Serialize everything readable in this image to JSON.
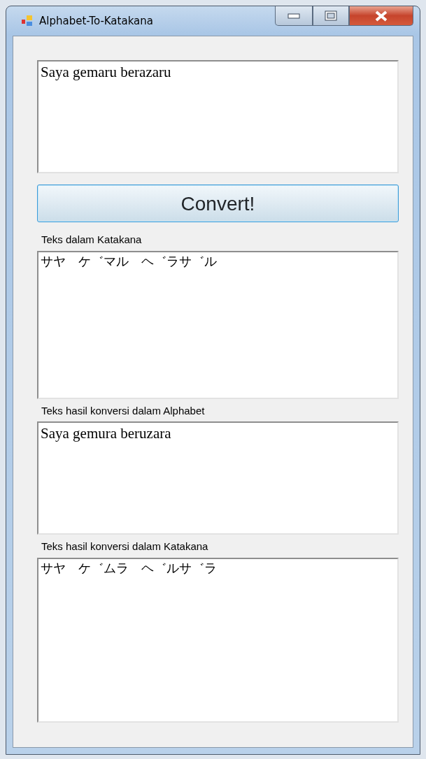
{
  "window": {
    "title": "Alphabet-To-Katakana",
    "controls": [
      {
        "kind": "minimize"
      },
      {
        "kind": "maximize"
      },
      {
        "kind": "close"
      }
    ]
  },
  "input": {
    "value": "Saya gemaru berazaru",
    "kind": "alphabet"
  },
  "button": {
    "label": "Convert!"
  },
  "outputs": [
    {
      "label": "Teks dalam Katakana",
      "value": "サヤ　ケ゛マル　ヘ゛ラサ゛ル",
      "kind": "katakana"
    },
    {
      "label": "Teks hasil konversi dalam Alphabet",
      "value": "Saya gemura beruzara",
      "kind": "alphabet"
    },
    {
      "label": "Teks hasil konversi dalam Katakana",
      "value": "サヤ　ケ゛ムラ　ヘ゛ルサ゛ラ",
      "kind": "katakana"
    }
  ]
}
